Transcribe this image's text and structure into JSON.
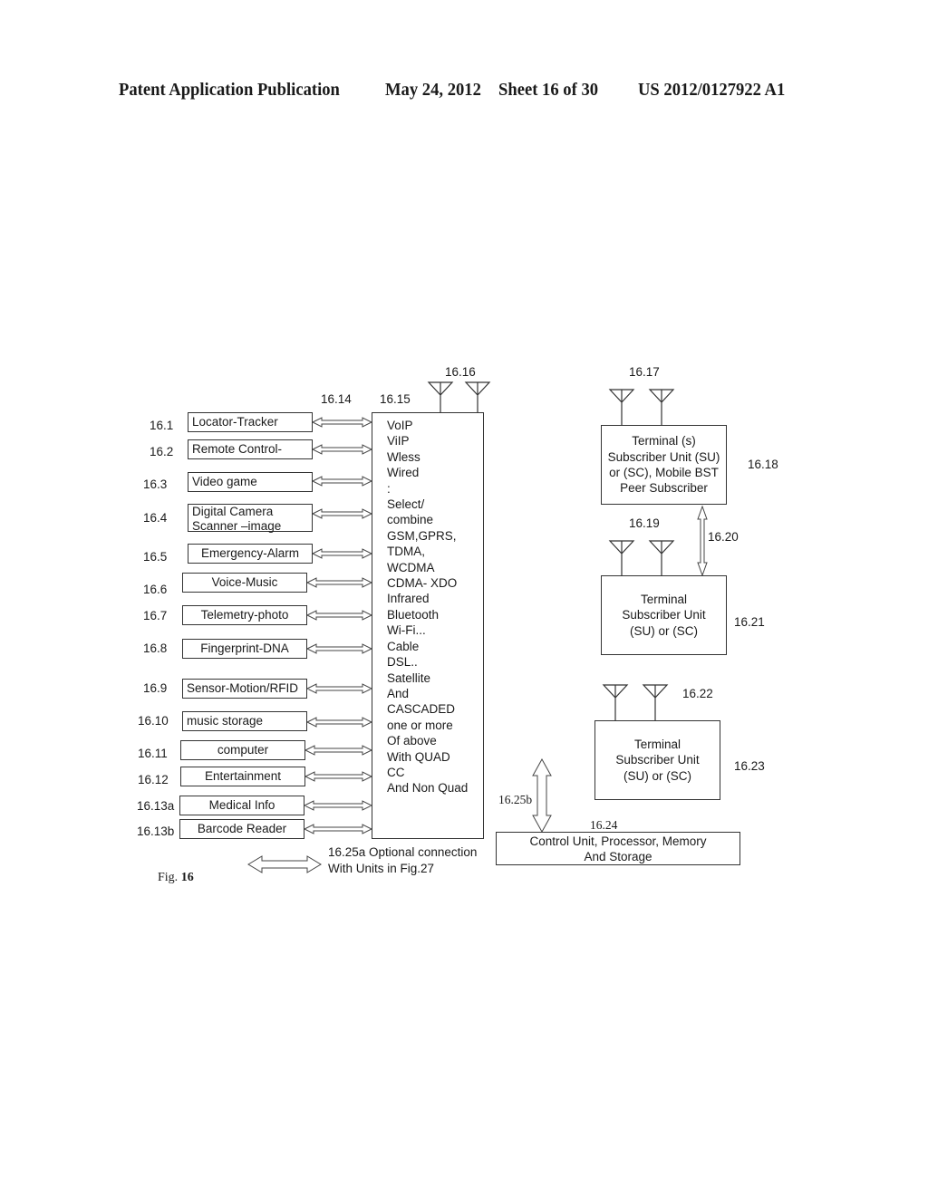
{
  "header": {
    "publication": "Patent Application Publication",
    "date": "May 24, 2012",
    "sheet": "Sheet 16 of 30",
    "number": "US 2012/0127922 A1"
  },
  "figure": {
    "caption": "Fig.",
    "caption_num": "16"
  },
  "refs": {
    "arrows": "16.14",
    "protocol_box": "16.15",
    "antenna_main": "16.16",
    "antenna_t1": "16.17",
    "terminal1": "16.18",
    "antenna_t2": "16.19",
    "link_t1_t2": "16.20",
    "terminal2": "16.21",
    "antenna_t3": "16.22",
    "terminal3": "16.23",
    "control": "16.24",
    "link_control": "16.25b"
  },
  "devices": [
    {
      "ref": "16.1",
      "lines": [
        "Locator-Tracker"
      ]
    },
    {
      "ref": "16.2",
      "lines": [
        "Remote Control-"
      ]
    },
    {
      "ref": "16.3",
      "lines": [
        "Video game"
      ]
    },
    {
      "ref": "16.4",
      "lines": [
        "Digital Camera",
        "Scanner –image"
      ]
    },
    {
      "ref": "16.5",
      "lines": [
        "Emergency-Alarm"
      ]
    },
    {
      "ref": "16.6",
      "lines": [
        "Voice-Music"
      ]
    },
    {
      "ref": "16.7",
      "lines": [
        "Telemetry-photo"
      ]
    },
    {
      "ref": "16.8",
      "lines": [
        "Fingerprint-DNA"
      ]
    },
    {
      "ref": "16.9",
      "lines": [
        "Sensor-Motion/RFID"
      ]
    },
    {
      "ref": "16.10",
      "lines": [
        "music storage"
      ]
    },
    {
      "ref": "16.11",
      "lines": [
        "computer"
      ]
    },
    {
      "ref": "16.12",
      "lines": [
        "Entertainment"
      ]
    },
    {
      "ref": "16.13a",
      "lines": [
        "Medical Info"
      ]
    },
    {
      "ref": "16.13b",
      "lines": [
        "Barcode Reader"
      ]
    }
  ],
  "protocols": [
    "VoIP",
    "ViIP",
    "Wless",
    "Wired",
    ":",
    "Select/",
    "combine",
    "GSM,GPRS,",
    " TDMA,",
    "WCDMA",
    "CDMA- XDO",
    "Infrared",
    "Bluetooth",
    "Wi-Fi...",
    "Cable",
    "DSL..",
    "Satellite",
    "And",
    "CASCADED",
    "one or more",
    "Of above",
    "With QUAD",
    "CC",
    "And Non Quad"
  ],
  "terminal1": [
    "Terminal (s)",
    "Subscriber Unit (SU)",
    "or (SC), Mobile BST",
    "Peer Subscriber"
  ],
  "terminal2": [
    "Terminal",
    "Subscriber Unit",
    "(SU) or (SC)"
  ],
  "terminal3": [
    "Terminal",
    "Subscriber Unit",
    "(SU) or (SC)"
  ],
  "control": [
    "Control Unit, Processor, Memory",
    "And Storage"
  ],
  "legend": [
    "16.25a Optional connection",
    "With Units in Fig.27"
  ]
}
